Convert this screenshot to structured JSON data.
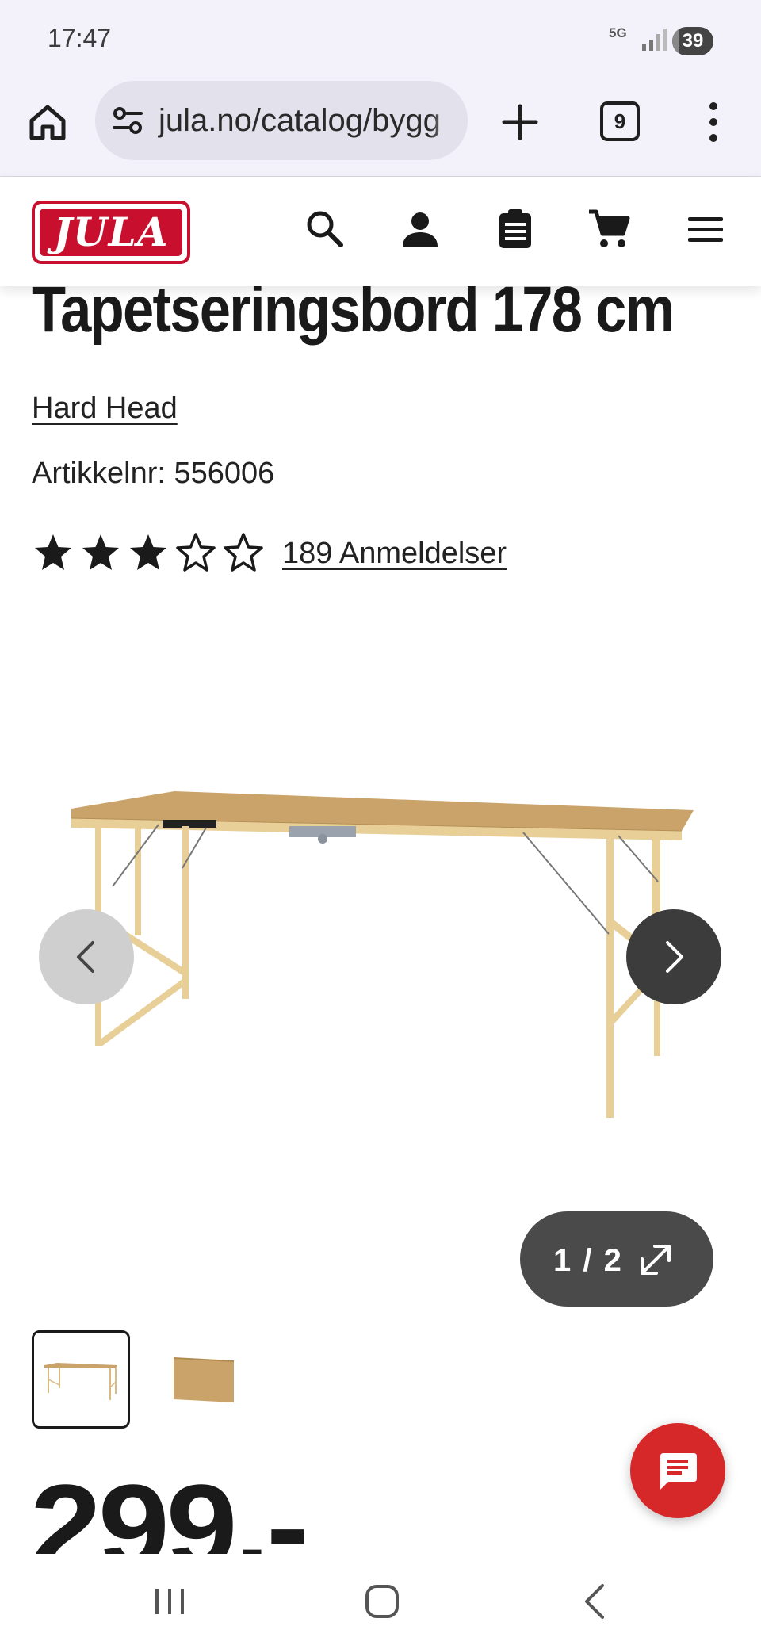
{
  "status_bar": {
    "time": "17:47",
    "network": "5G",
    "battery": "39"
  },
  "browser": {
    "url": "jula.no/catalog/bygg",
    "tab_count": "9"
  },
  "site": {
    "logo_text": "JULA",
    "icons": [
      "search-icon",
      "account-icon",
      "shopping-list-icon",
      "cart-icon",
      "menu-icon"
    ]
  },
  "product": {
    "title": "Tapetseringsbord 178 cm",
    "brand": "Hard Head",
    "article_number": "Artikkelnr: 556006",
    "rating": 3,
    "rating_max": 5,
    "reviews": "189 Anmeldelser",
    "price": "299,-"
  },
  "gallery": {
    "counter": "1 / 2",
    "current": 1,
    "total": 2
  },
  "colors": {
    "brand_red": "#d62828",
    "dark": "#1a1a1a",
    "toolbar_bg": "#f3f1f9",
    "wood": "#e8cf98",
    "board": "#c9a36a"
  }
}
